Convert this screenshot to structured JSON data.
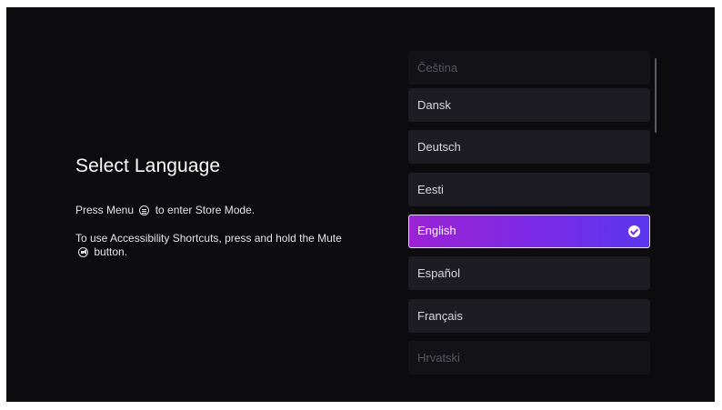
{
  "header": {
    "title": "Select Language"
  },
  "hints": {
    "menu_before": "Press Menu",
    "menu_after": "to enter Store Mode.",
    "access_before": "To use Accessibility Shortcuts, press and hold the Mute",
    "access_after": "button."
  },
  "icons": {
    "menu": "menu-button-icon",
    "mute": "mute-button-icon",
    "check": "check-circle-icon"
  },
  "languages": {
    "items": [
      {
        "label": "Čeština",
        "state": "faded"
      },
      {
        "label": "Dansk",
        "state": "normal"
      },
      {
        "label": "Deutsch",
        "state": "normal"
      },
      {
        "label": "Eesti",
        "state": "normal"
      },
      {
        "label": "English",
        "state": "selected"
      },
      {
        "label": "Español",
        "state": "normal"
      },
      {
        "label": "Français",
        "state": "normal"
      },
      {
        "label": "Hrvatski",
        "state": "faded"
      }
    ]
  },
  "colors": {
    "background": "#0c0c0f",
    "item": "#1c1c22",
    "accent_start": "#9b23d4",
    "accent_end": "#5a36ee"
  }
}
